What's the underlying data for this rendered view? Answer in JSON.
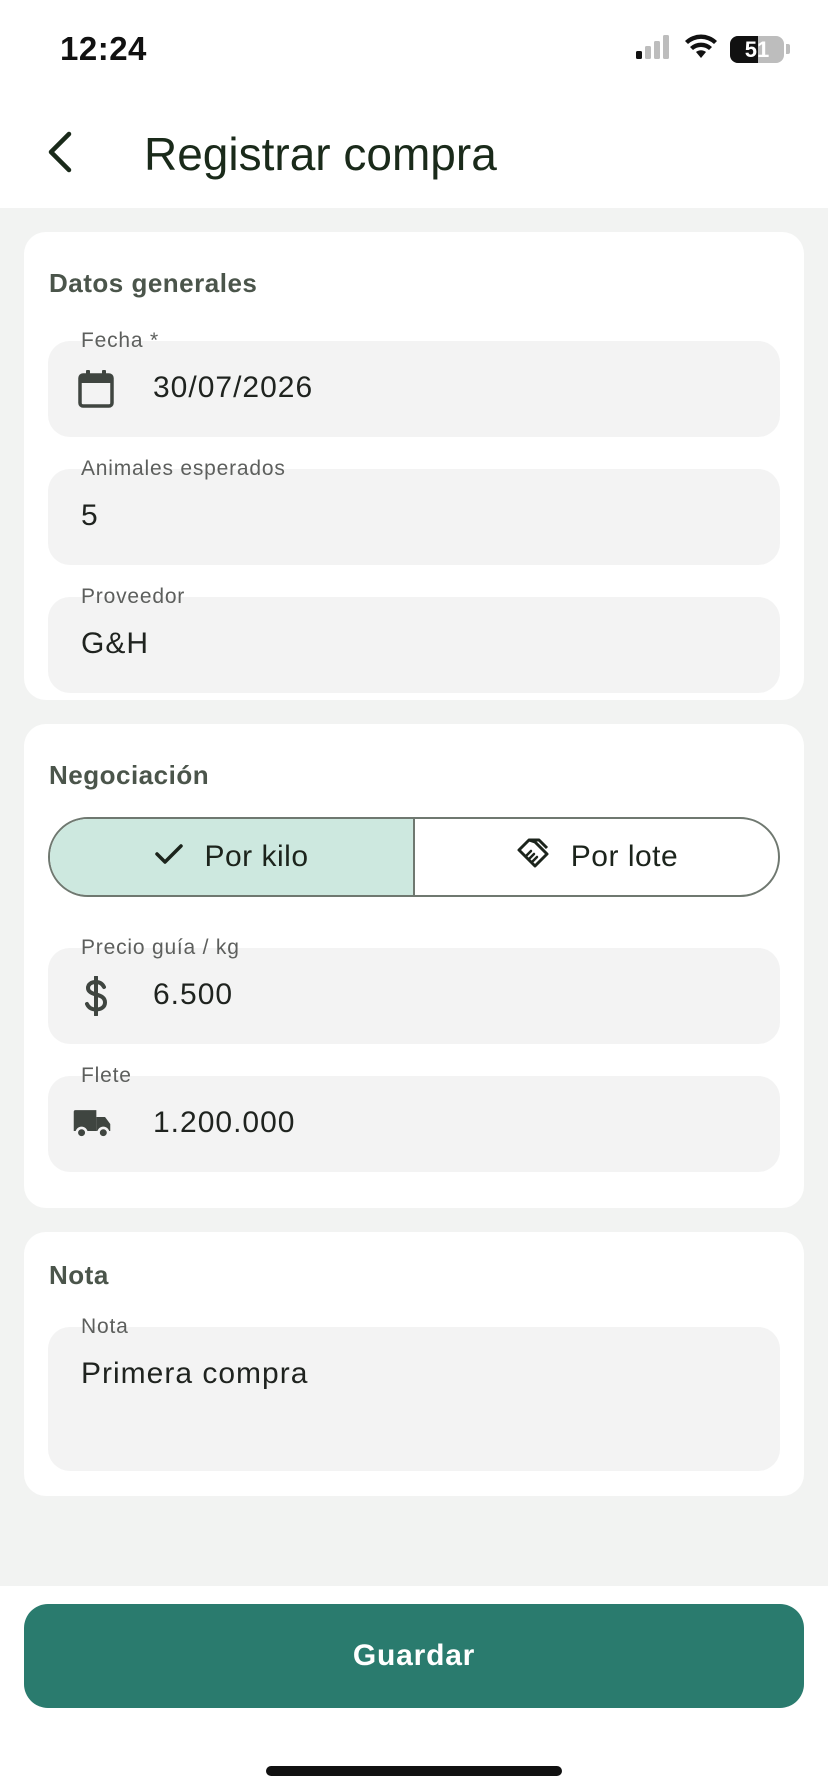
{
  "status": {
    "time": "12:24",
    "battery": "51",
    "battery_level": 0.51,
    "signal_icon": "cellular-signal-icon",
    "wifi_icon": "wifi-icon"
  },
  "header": {
    "back_icon": "chevron-left-icon",
    "title": "Registrar compra"
  },
  "general": {
    "title": "Datos generales",
    "date": {
      "label": "Fecha *",
      "value": "30/07/2026",
      "icon": "calendar-icon"
    },
    "animals": {
      "label": "Animales esperados",
      "value": "5"
    },
    "supplier": {
      "label": "Proveedor",
      "value": "G&H"
    }
  },
  "negotiation": {
    "title": "Negociación",
    "options": [
      {
        "label": "Por kilo",
        "icon": "check-icon",
        "selected": true
      },
      {
        "label": "Por lote",
        "icon": "handshake-icon",
        "selected": false
      }
    ],
    "price": {
      "label": "Precio guía / kg",
      "value": "6.500",
      "icon": "dollar-icon"
    },
    "freight": {
      "label": "Flete",
      "value": "1.200.000",
      "icon": "truck-icon"
    }
  },
  "note": {
    "title": "Nota",
    "label": "Nota",
    "value": "Primera compra"
  },
  "actions": {
    "save_label": "Guardar"
  },
  "colors": {
    "primary": "#2a7b6e",
    "selected_segment": "#cde8df",
    "field_background": "#f3f3f3",
    "page_background": "#f2f3f2"
  }
}
